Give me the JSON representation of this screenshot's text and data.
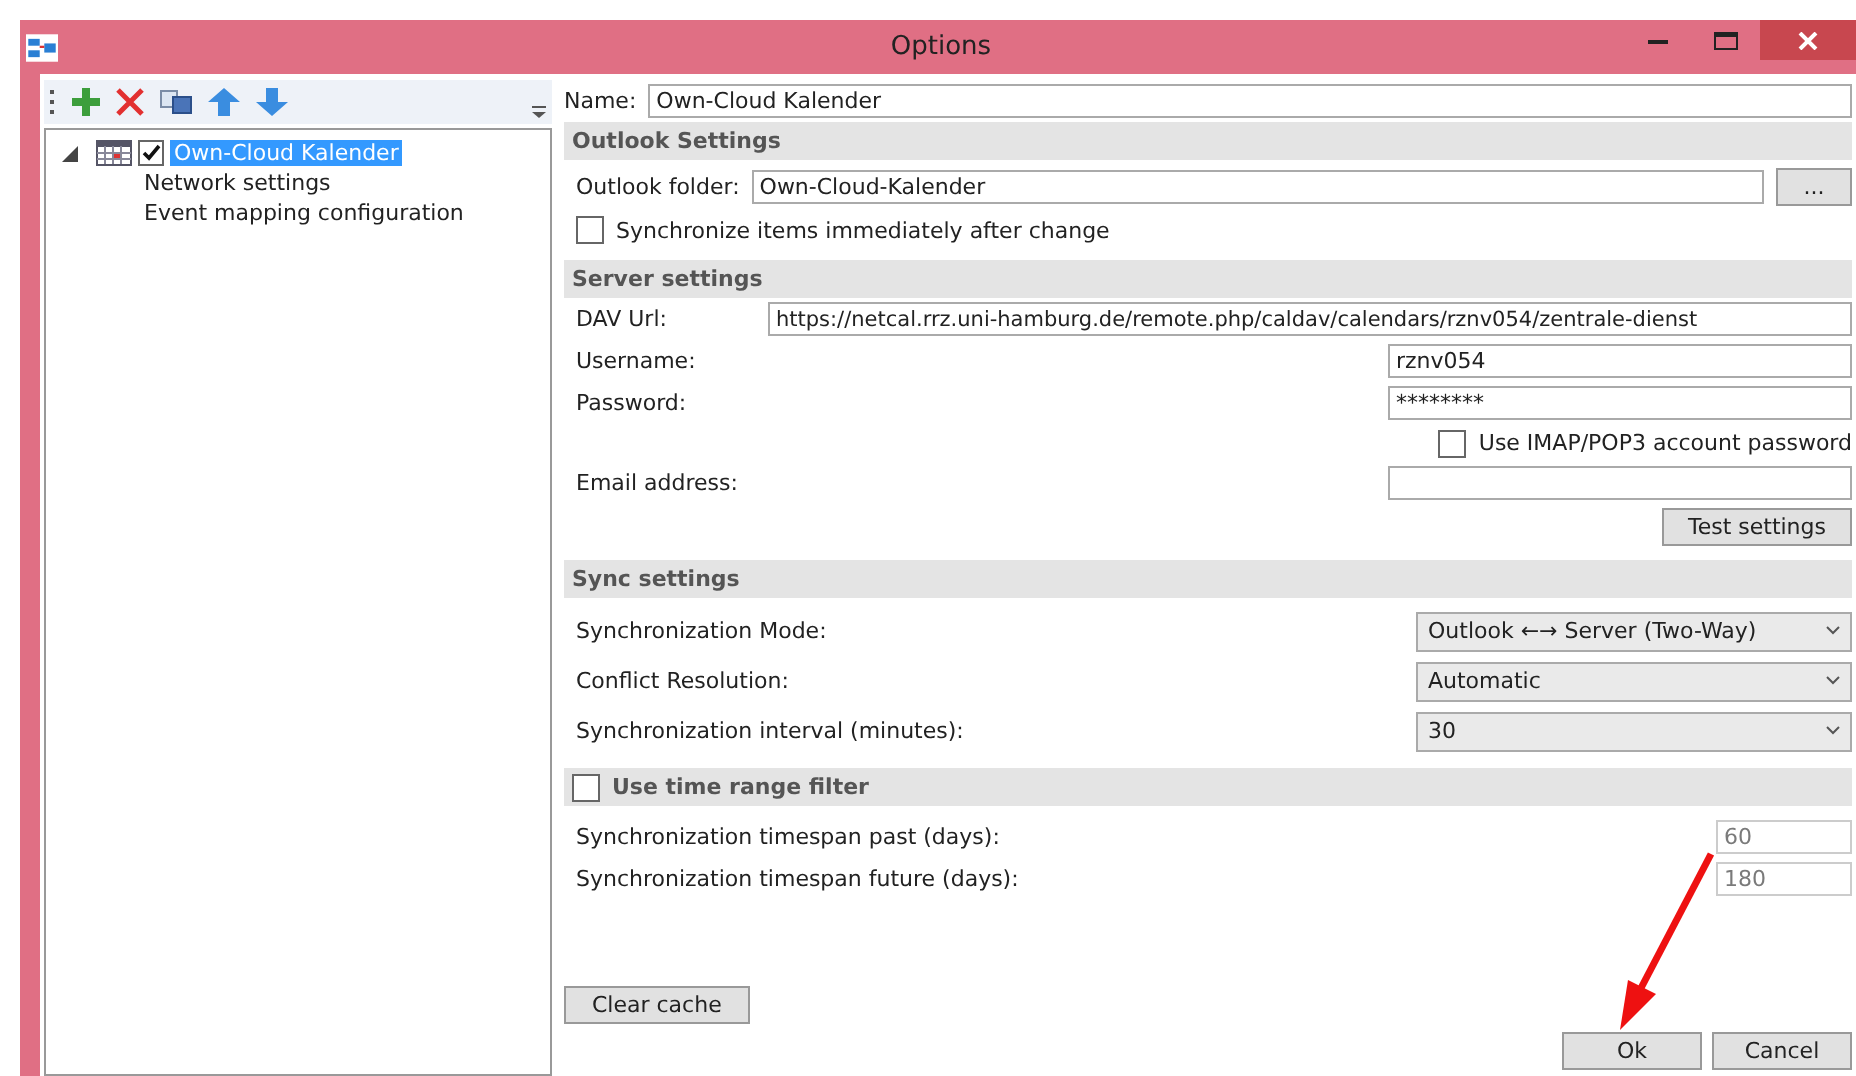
{
  "window": {
    "title": "Options"
  },
  "tree": [
    {
      "label": "Own-Cloud Kalender",
      "checked": true,
      "expanded": true,
      "selected": true,
      "children": [
        {
          "label": "Network settings",
          "selected": false
        },
        {
          "label": "Event mapping configuration",
          "selected": false
        }
      ]
    }
  ],
  "name": {
    "label": "Name:",
    "value": "Own-Cloud Kalender"
  },
  "outlook": {
    "title": "Outlook Settings",
    "folder_label": "Outlook folder:",
    "folder_value": "Own-Cloud-Kalender",
    "browse_button": "...",
    "sync_immediately": {
      "label": "Synchronize items immediately after change",
      "checked": false
    }
  },
  "server": {
    "title": "Server settings",
    "url_label": "DAV Url:",
    "url_value": "https://netcal.rrz.uni-hamburg.de/remote.php/caldav/calendars/rznv054/zentrale-dienst",
    "username_label": "Username:",
    "username_value": "rznv054",
    "password_label": "Password:",
    "password_value": "********",
    "imap": {
      "label": "Use IMAP/POP3 account password",
      "checked": false
    },
    "email_label": "Email address:",
    "test_button": "Test settings"
  },
  "sync": {
    "title": "Sync settings",
    "rows": [
      {
        "label": "Synchronization Mode:",
        "value": "Outlook ←→ Server (Two-Way)"
      },
      {
        "label": "Conflict Resolution:",
        "value": "Automatic"
      },
      {
        "label": "Synchronization interval (minutes):",
        "value": "30"
      }
    ]
  },
  "time_range": {
    "label": "Use time range filter",
    "checked": false,
    "rows": [
      {
        "label": "Synchronization timespan past (days):",
        "value": "60",
        "disabled": true
      },
      {
        "label": "Synchronization timespan future (days):",
        "value": "180",
        "disabled": true
      }
    ]
  },
  "buttons": {
    "clear_cache": "Clear cache",
    "ok": "Ok",
    "cancel": "Cancel"
  }
}
